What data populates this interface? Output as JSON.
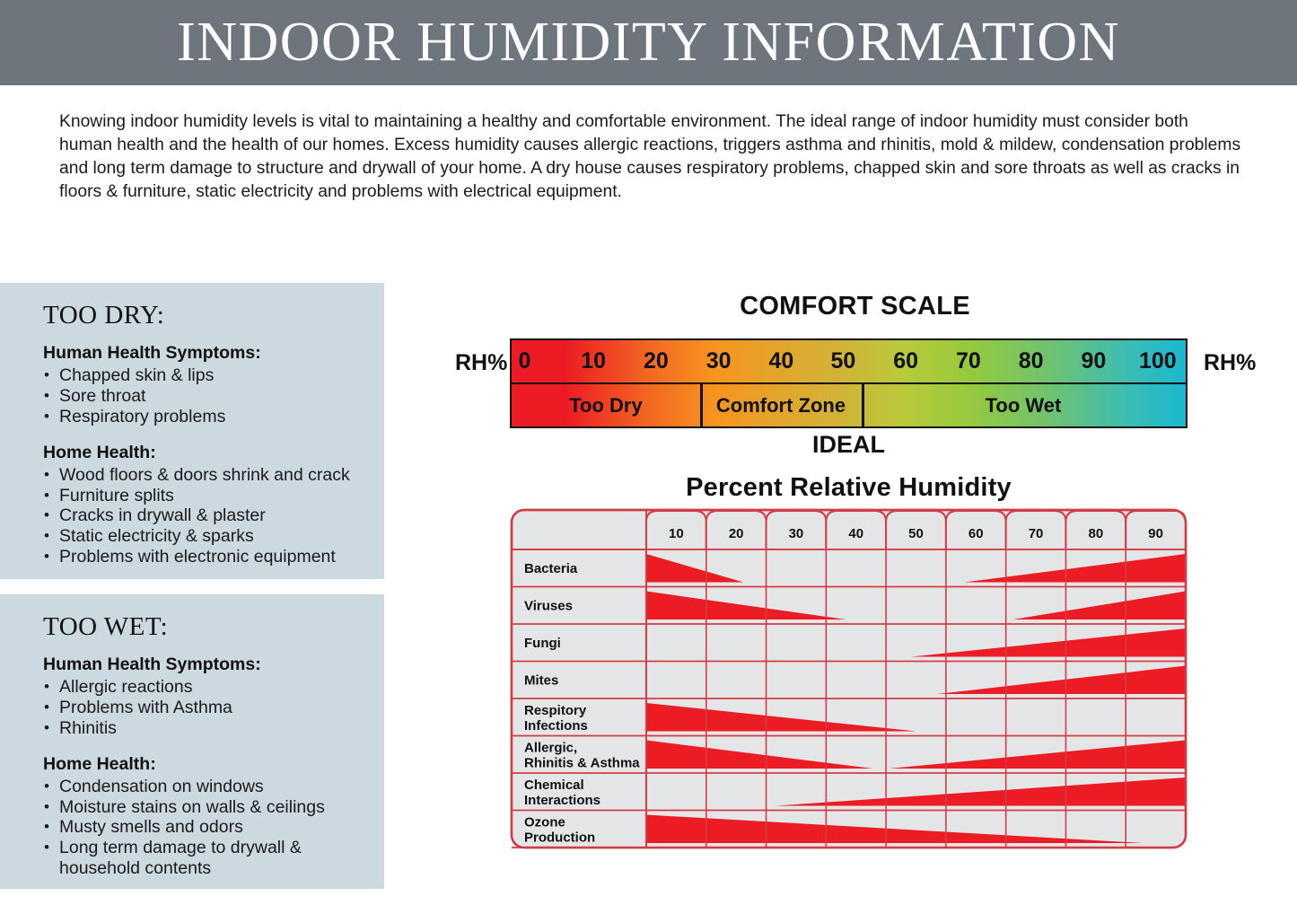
{
  "header": {
    "title": "INDOOR HUMIDITY INFORMATION",
    "bg_color": "#6e757c",
    "text_color": "#ffffff"
  },
  "intro": {
    "paragraph": "Knowing indoor humidity levels is vital to maintaining a healthy and comfortable environment. The ideal range of indoor humidity must consider both human health and the health of our homes. Excess humidity causes allergic reactions, triggers asthma and rhinitis, mold & mildew, condensation problems and long term damage to structure and drywall of your home. A dry house causes respiratory problems, chapped skin and sore throats as well as cracks in floors & furniture, static electricity and problems with electrical equipment."
  },
  "panels": [
    {
      "id": "too-dry",
      "title": "TOO DRY:",
      "bg_color": "#cdd9e0",
      "groups": [
        {
          "heading": "Human Health Symptoms:",
          "items": [
            "Chapped skin & lips",
            "Sore throat",
            "Respiratory problems"
          ]
        },
        {
          "heading": "Home Health:",
          "items": [
            "Wood floors & doors shrink and crack",
            "Furniture splits",
            "Cracks in drywall & plaster",
            "Static electricity & sparks",
            "Problems with electronic equipment"
          ]
        }
      ]
    },
    {
      "id": "too-wet",
      "title": "TOO WET:",
      "bg_color": "#cdd9e0",
      "groups": [
        {
          "heading": "Human Health Symptoms:",
          "items": [
            "Allergic reactions",
            "Problems with Asthma",
            "Rhinitis"
          ]
        },
        {
          "heading": "Home Health:",
          "items": [
            "Condensation on windows",
            "Moisture stains on walls & ceilings",
            "Musty smells and odors",
            "Long term damage to drywall & household contents"
          ]
        }
      ]
    }
  ],
  "comfort_scale": {
    "title": "COMFORT SCALE",
    "rh_label_left": "RH%",
    "rh_label_right": "RH%",
    "ideal_label": "IDEAL",
    "ticks": [
      "0",
      "10",
      "20",
      "30",
      "40",
      "50",
      "60",
      "70",
      "80",
      "90",
      "100"
    ],
    "zones": [
      {
        "label": "Too Dry",
        "start": 0,
        "end": 28
      },
      {
        "label": "Comfort Zone",
        "start": 28,
        "end": 52
      },
      {
        "label": "Too Wet",
        "start": 52,
        "end": 100
      }
    ],
    "gradient_stops": [
      "#ed1c24",
      "#f26522",
      "#f7941e",
      "#d3b136",
      "#96c93d",
      "#6ec271",
      "#19b8d0"
    ]
  },
  "chart_data": {
    "type": "area",
    "title": "Percent Relative Humidity",
    "xlabel": "Percent Relative Humidity",
    "ylabel": "",
    "categories": [
      "10",
      "20",
      "30",
      "40",
      "50",
      "60",
      "70",
      "80",
      "90"
    ],
    "xlim": [
      5,
      95
    ],
    "grid": true,
    "legend": "none",
    "bar_color": "#ec1c24",
    "cell_color": "#e4e5e7",
    "border_color": "#d13c47",
    "series": [
      {
        "name": "Bacteria",
        "left_wedge_end": 0.18,
        "right_wedge_start": 0.59
      },
      {
        "name": "Viruses",
        "left_wedge_end": 0.37,
        "right_wedge_start": 0.68
      },
      {
        "name": "Fungi",
        "left_wedge_end": null,
        "right_wedge_start": 0.49
      },
      {
        "name": "Mites",
        "left_wedge_end": null,
        "right_wedge_start": 0.54
      },
      {
        "name": "Respitory Infections",
        "left_wedge_end": 0.5,
        "right_wedge_start": null
      },
      {
        "name": "Allergic, Rhinitis & Asthma",
        "left_wedge_end": 0.42,
        "right_wedge_start": 0.45
      },
      {
        "name": "Chemical Interactions",
        "left_wedge_end": null,
        "right_wedge_start": 0.24
      },
      {
        "name": "Ozone Production",
        "left_wedge_end": 0.92,
        "right_wedge_start": null
      }
    ],
    "row_labels": [
      [
        "Bacteria"
      ],
      [
        "Viruses"
      ],
      [
        "Fungi"
      ],
      [
        "Mites"
      ],
      [
        "Respitory",
        "Infections"
      ],
      [
        "Allergic,",
        "Rhinitis & Asthma"
      ],
      [
        "Chemical",
        "Interactions"
      ],
      [
        "Ozone",
        "Production"
      ]
    ]
  }
}
